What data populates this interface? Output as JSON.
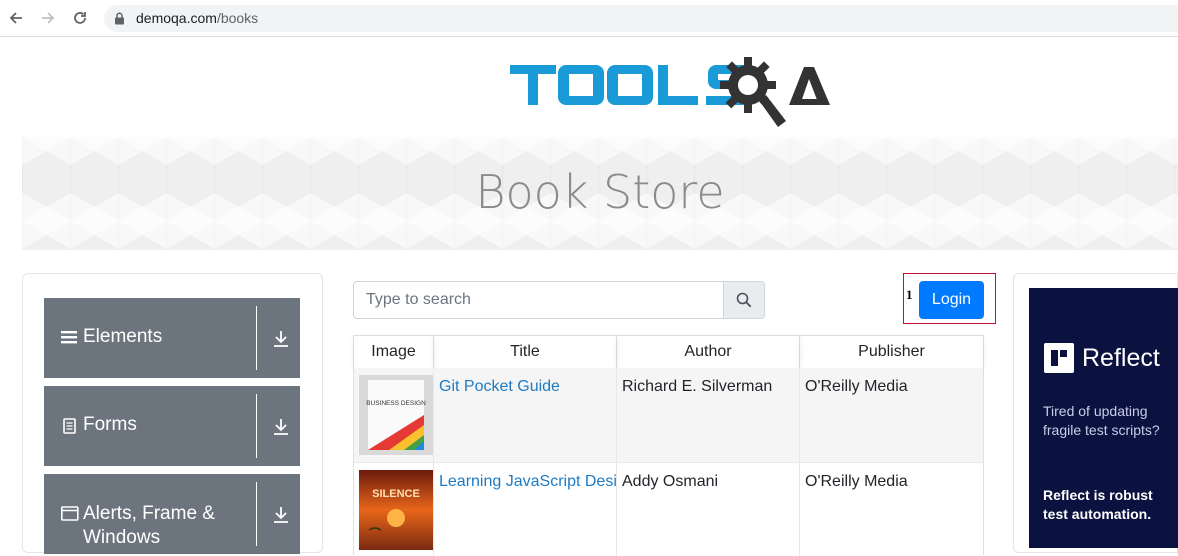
{
  "browser": {
    "url_host": "demoqa.com",
    "url_path": "/books"
  },
  "banner": {
    "title": "Book Store"
  },
  "sidebar": {
    "groups": [
      {
        "label": "Elements",
        "icon": "hamburger-icon"
      },
      {
        "label": "Forms",
        "icon": "document-icon"
      },
      {
        "label": "Alerts, Frame & Windows",
        "icon": "window-icon"
      }
    ]
  },
  "search": {
    "placeholder": "Type to search"
  },
  "login": {
    "marker": "1",
    "label": "Login"
  },
  "table": {
    "headers": [
      "Image",
      "Title",
      "Author",
      "Publisher"
    ],
    "rows": [
      {
        "title": "Git Pocket Guide",
        "author": "Richard E. Silverman",
        "publisher": "O'Reilly Media",
        "cover_text": "BUSINESS DESIGN"
      },
      {
        "title": "Learning JavaScript Design Patterns",
        "author": "Addy Osmani",
        "publisher": "O'Reilly Media",
        "cover_text": "SILENCE"
      }
    ]
  },
  "ad": {
    "brand": "Reflect",
    "text": "Tired of updating fragile test scripts?",
    "strong": "Reflect is robust test automation."
  },
  "colors": {
    "accent": "#007bff",
    "sidebar_group": "#6c757d",
    "link": "#1e7bc3",
    "logo_blue": "#1a9bd7",
    "logo_dark": "#333333"
  }
}
